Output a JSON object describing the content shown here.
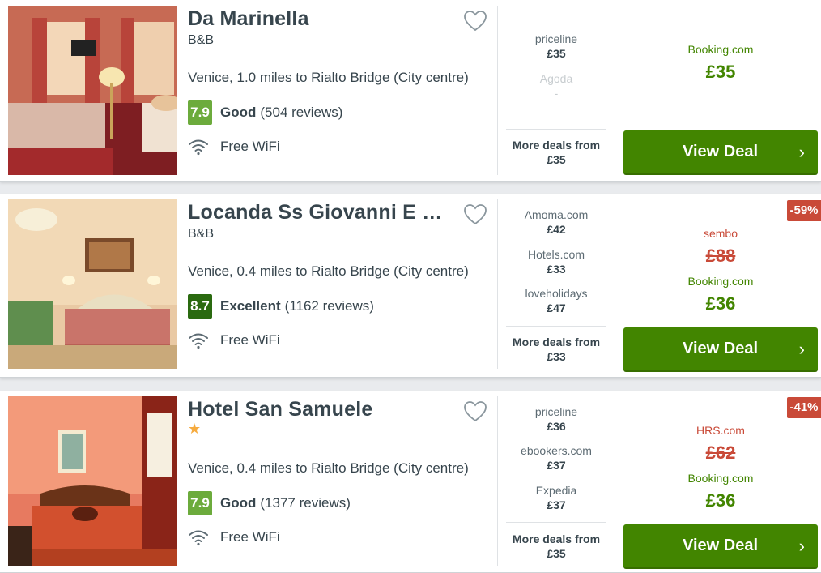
{
  "results": [
    {
      "name": "Da Marinella",
      "type": "B&B",
      "location": "Venice, 1.0 miles to Rialto Bridge (City centre)",
      "rating": {
        "score": "7.9",
        "label": "Good",
        "count": "(504 reviews)",
        "color": "#6cab3c"
      },
      "amenity": "Free WiFi",
      "other_deals": [
        {
          "provider": "priceline",
          "price": "£35"
        },
        {
          "provider": "Agoda",
          "price": "-"
        }
      ],
      "more_deals": {
        "label": "More deals from",
        "price": "£35"
      },
      "main_deal": {
        "provider": "Booking.com",
        "price": "£35"
      },
      "button_label": "View Deal"
    },
    {
      "name": "Locanda Ss Giovanni E …",
      "type": "B&B",
      "location": "Venice, 0.4 miles to Rialto Bridge (City centre)",
      "rating": {
        "score": "8.7",
        "label": "Excellent",
        "count": "(1162 reviews)",
        "color": "#2a6a10"
      },
      "amenity": "Free WiFi",
      "other_deals": [
        {
          "provider": "Amoma.com",
          "price": "£42"
        },
        {
          "provider": "Hotels.com",
          "price": "£33"
        },
        {
          "provider": "loveholidays",
          "price": "£47"
        }
      ],
      "more_deals": {
        "label": "More deals from",
        "price": "£33"
      },
      "discount": "-59%",
      "strike_deal": {
        "provider": "sembo",
        "price": "£88"
      },
      "main_deal": {
        "provider": "Booking.com",
        "price": "£36"
      },
      "button_label": "View Deal"
    },
    {
      "name": "Hotel San Samuele",
      "stars": "★",
      "location": "Venice, 0.4 miles to Rialto Bridge (City centre)",
      "rating": {
        "score": "7.9",
        "label": "Good",
        "count": "(1377 reviews)",
        "color": "#6cab3c"
      },
      "amenity": "Free WiFi",
      "other_deals": [
        {
          "provider": "priceline",
          "price": "£36"
        },
        {
          "provider": "ebookers.com",
          "price": "£37"
        },
        {
          "provider": "Expedia",
          "price": "£37"
        }
      ],
      "more_deals": {
        "label": "More deals from",
        "price": "£35"
      },
      "discount": "-41%",
      "strike_deal": {
        "provider": "HRS.com",
        "price": "£62"
      },
      "main_deal": {
        "provider": "Booking.com",
        "price": "£36"
      },
      "button_label": "View Deal"
    }
  ],
  "icons": {
    "favorite": "heart-outline-icon",
    "wifi": "wifi-icon",
    "chevron": "chevron-right-icon"
  }
}
